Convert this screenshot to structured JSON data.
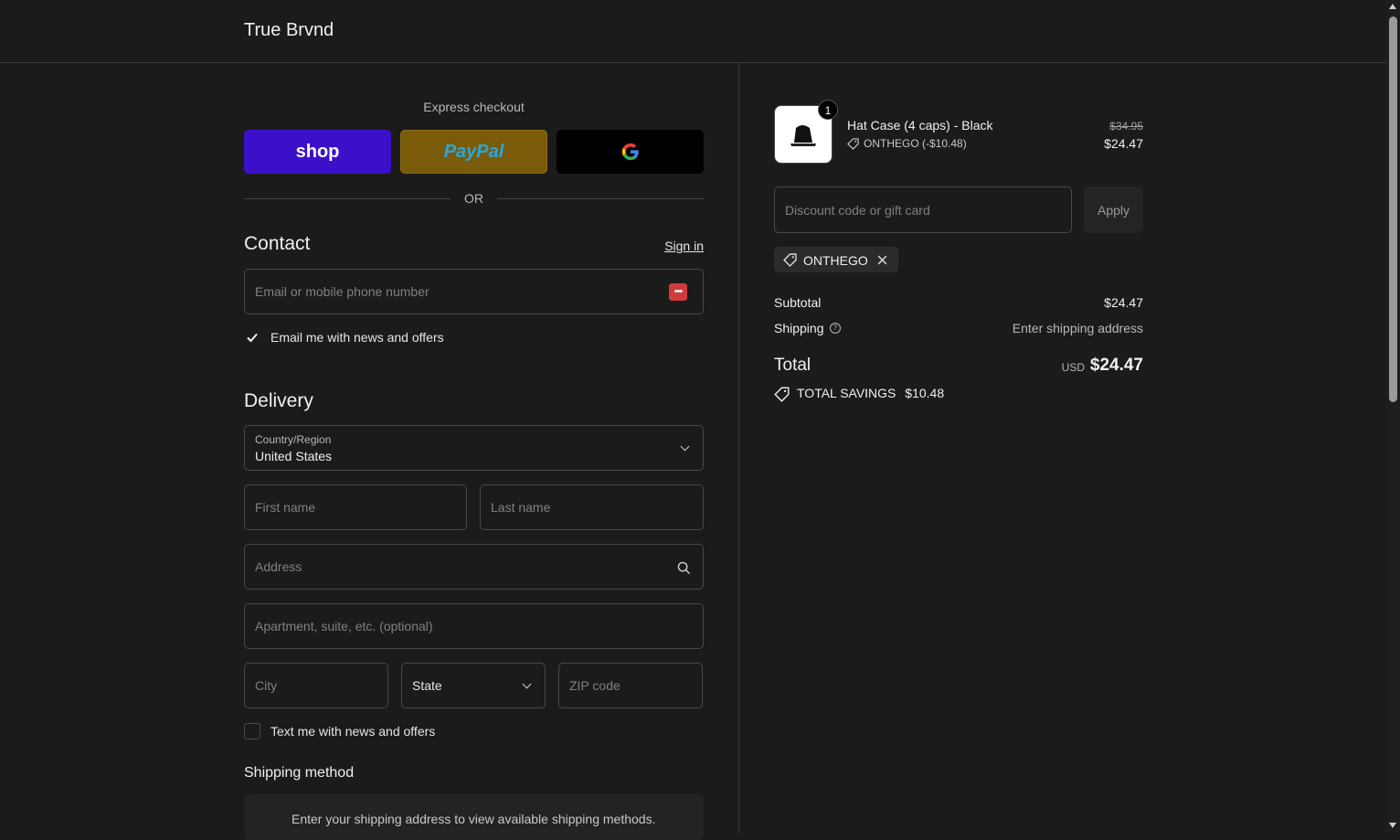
{
  "header": {
    "brand": "True Brvnd"
  },
  "express": {
    "label": "Express checkout",
    "shop_label": "shop",
    "paypal_label": "PayPal",
    "google_label": "G",
    "or_label": "OR"
  },
  "contact": {
    "title": "Contact",
    "signin_label": "Sign in",
    "email_placeholder": "Email or mobile phone number",
    "news_label": "Email me with news and offers",
    "news_checked": true
  },
  "delivery": {
    "title": "Delivery",
    "country_label": "Country/Region",
    "country_value": "United States",
    "first_name_placeholder": "First name",
    "last_name_placeholder": "Last name",
    "address_placeholder": "Address",
    "apartment_placeholder": "Apartment, suite, etc. (optional)",
    "city_placeholder": "City",
    "state_label": "State",
    "zip_placeholder": "ZIP code",
    "text_label": "Text me with news and offers",
    "text_checked": false
  },
  "shipping": {
    "title": "Shipping method",
    "message": "Enter your shipping address to view available shipping methods."
  },
  "summary": {
    "product": {
      "quantity": "1",
      "name": "Hat Case (4 caps) - Black",
      "discount": "ONTHEGO (-$10.48)",
      "original_price": "$34.95",
      "price": "$24.47"
    },
    "discount_placeholder": "Discount code or gift card",
    "apply_label": "Apply",
    "applied_code": "ONTHEGO",
    "subtotal_label": "Subtotal",
    "subtotal_value": "$24.47",
    "shipping_label": "Shipping",
    "shipping_value": "Enter shipping address",
    "total_label": "Total",
    "currency": "USD",
    "total_value": "$24.47",
    "savings_label": "TOTAL SAVINGS",
    "savings_value": "$10.48"
  },
  "colors": {
    "background": "#1b1b1b",
    "shop_button": "#3b10c9",
    "paypal_button": "#7a5b0a",
    "google_button": "#000000"
  }
}
